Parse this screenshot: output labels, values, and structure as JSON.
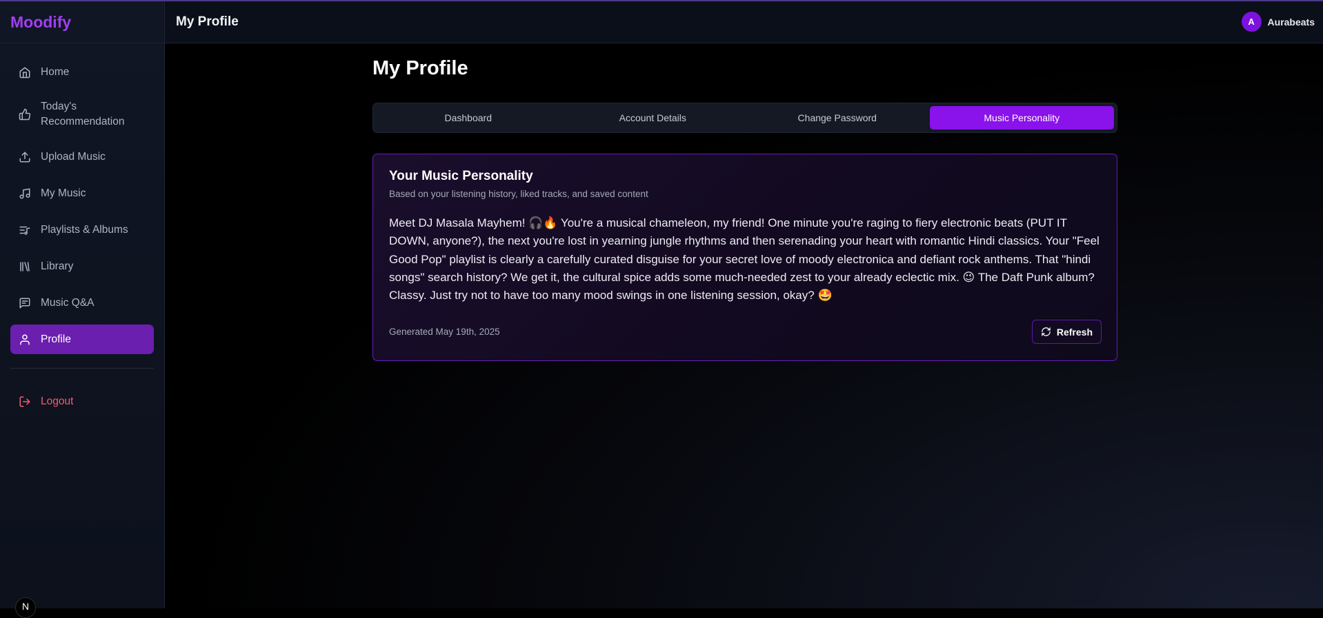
{
  "app": {
    "name": "Moodify"
  },
  "header": {
    "title": "My Profile",
    "user": {
      "initial": "A",
      "name": "Aurabeats"
    }
  },
  "sidebar": {
    "items": [
      {
        "label": "Home",
        "icon": "home-icon"
      },
      {
        "label": "Today's Recommendation",
        "icon": "thumbs-up-icon"
      },
      {
        "label": "Upload Music",
        "icon": "upload-icon"
      },
      {
        "label": "My Music",
        "icon": "music-note-icon"
      },
      {
        "label": "Playlists & Albums",
        "icon": "playlist-icon"
      },
      {
        "label": "Library",
        "icon": "library-icon"
      },
      {
        "label": "Music Q&A",
        "icon": "chat-icon"
      },
      {
        "label": "Profile",
        "icon": "user-icon",
        "active": true
      }
    ],
    "logout": {
      "label": "Logout",
      "icon": "logout-icon"
    },
    "corner_badge": "N"
  },
  "main": {
    "title": "My Profile",
    "tabs": [
      {
        "label": "Dashboard"
      },
      {
        "label": "Account Details"
      },
      {
        "label": "Change Password"
      },
      {
        "label": "Music Personality",
        "active": true
      }
    ],
    "card": {
      "title": "Your Music Personality",
      "subtitle": "Based on your listening history, liked tracks, and saved content",
      "body": "Meet DJ Masala Mayhem! 🎧🔥  You're a musical chameleon, my friend! One minute you're raging to fiery electronic beats (PUT IT DOWN, anyone?), the next you're lost in yearning jungle rhythms and then serenading your heart with romantic Hindi classics.  Your \"Feel Good Pop\" playlist is clearly a carefully curated disguise for your secret love of moody electronica and defiant rock anthems.  That \"hindi songs\" search history?  We get it, the cultural spice adds some much-needed zest to your already eclectic mix. 😉  The Daft Punk album?  Classy.  Just try not to have too many mood swings in one listening session, okay? 🤩",
      "generated": "Generated May 19th, 2025",
      "refresh_label": "Refresh"
    }
  },
  "colors": {
    "accent": "#8a12ea",
    "brand": "#a13ef2",
    "logout": "#ff5a6e"
  }
}
